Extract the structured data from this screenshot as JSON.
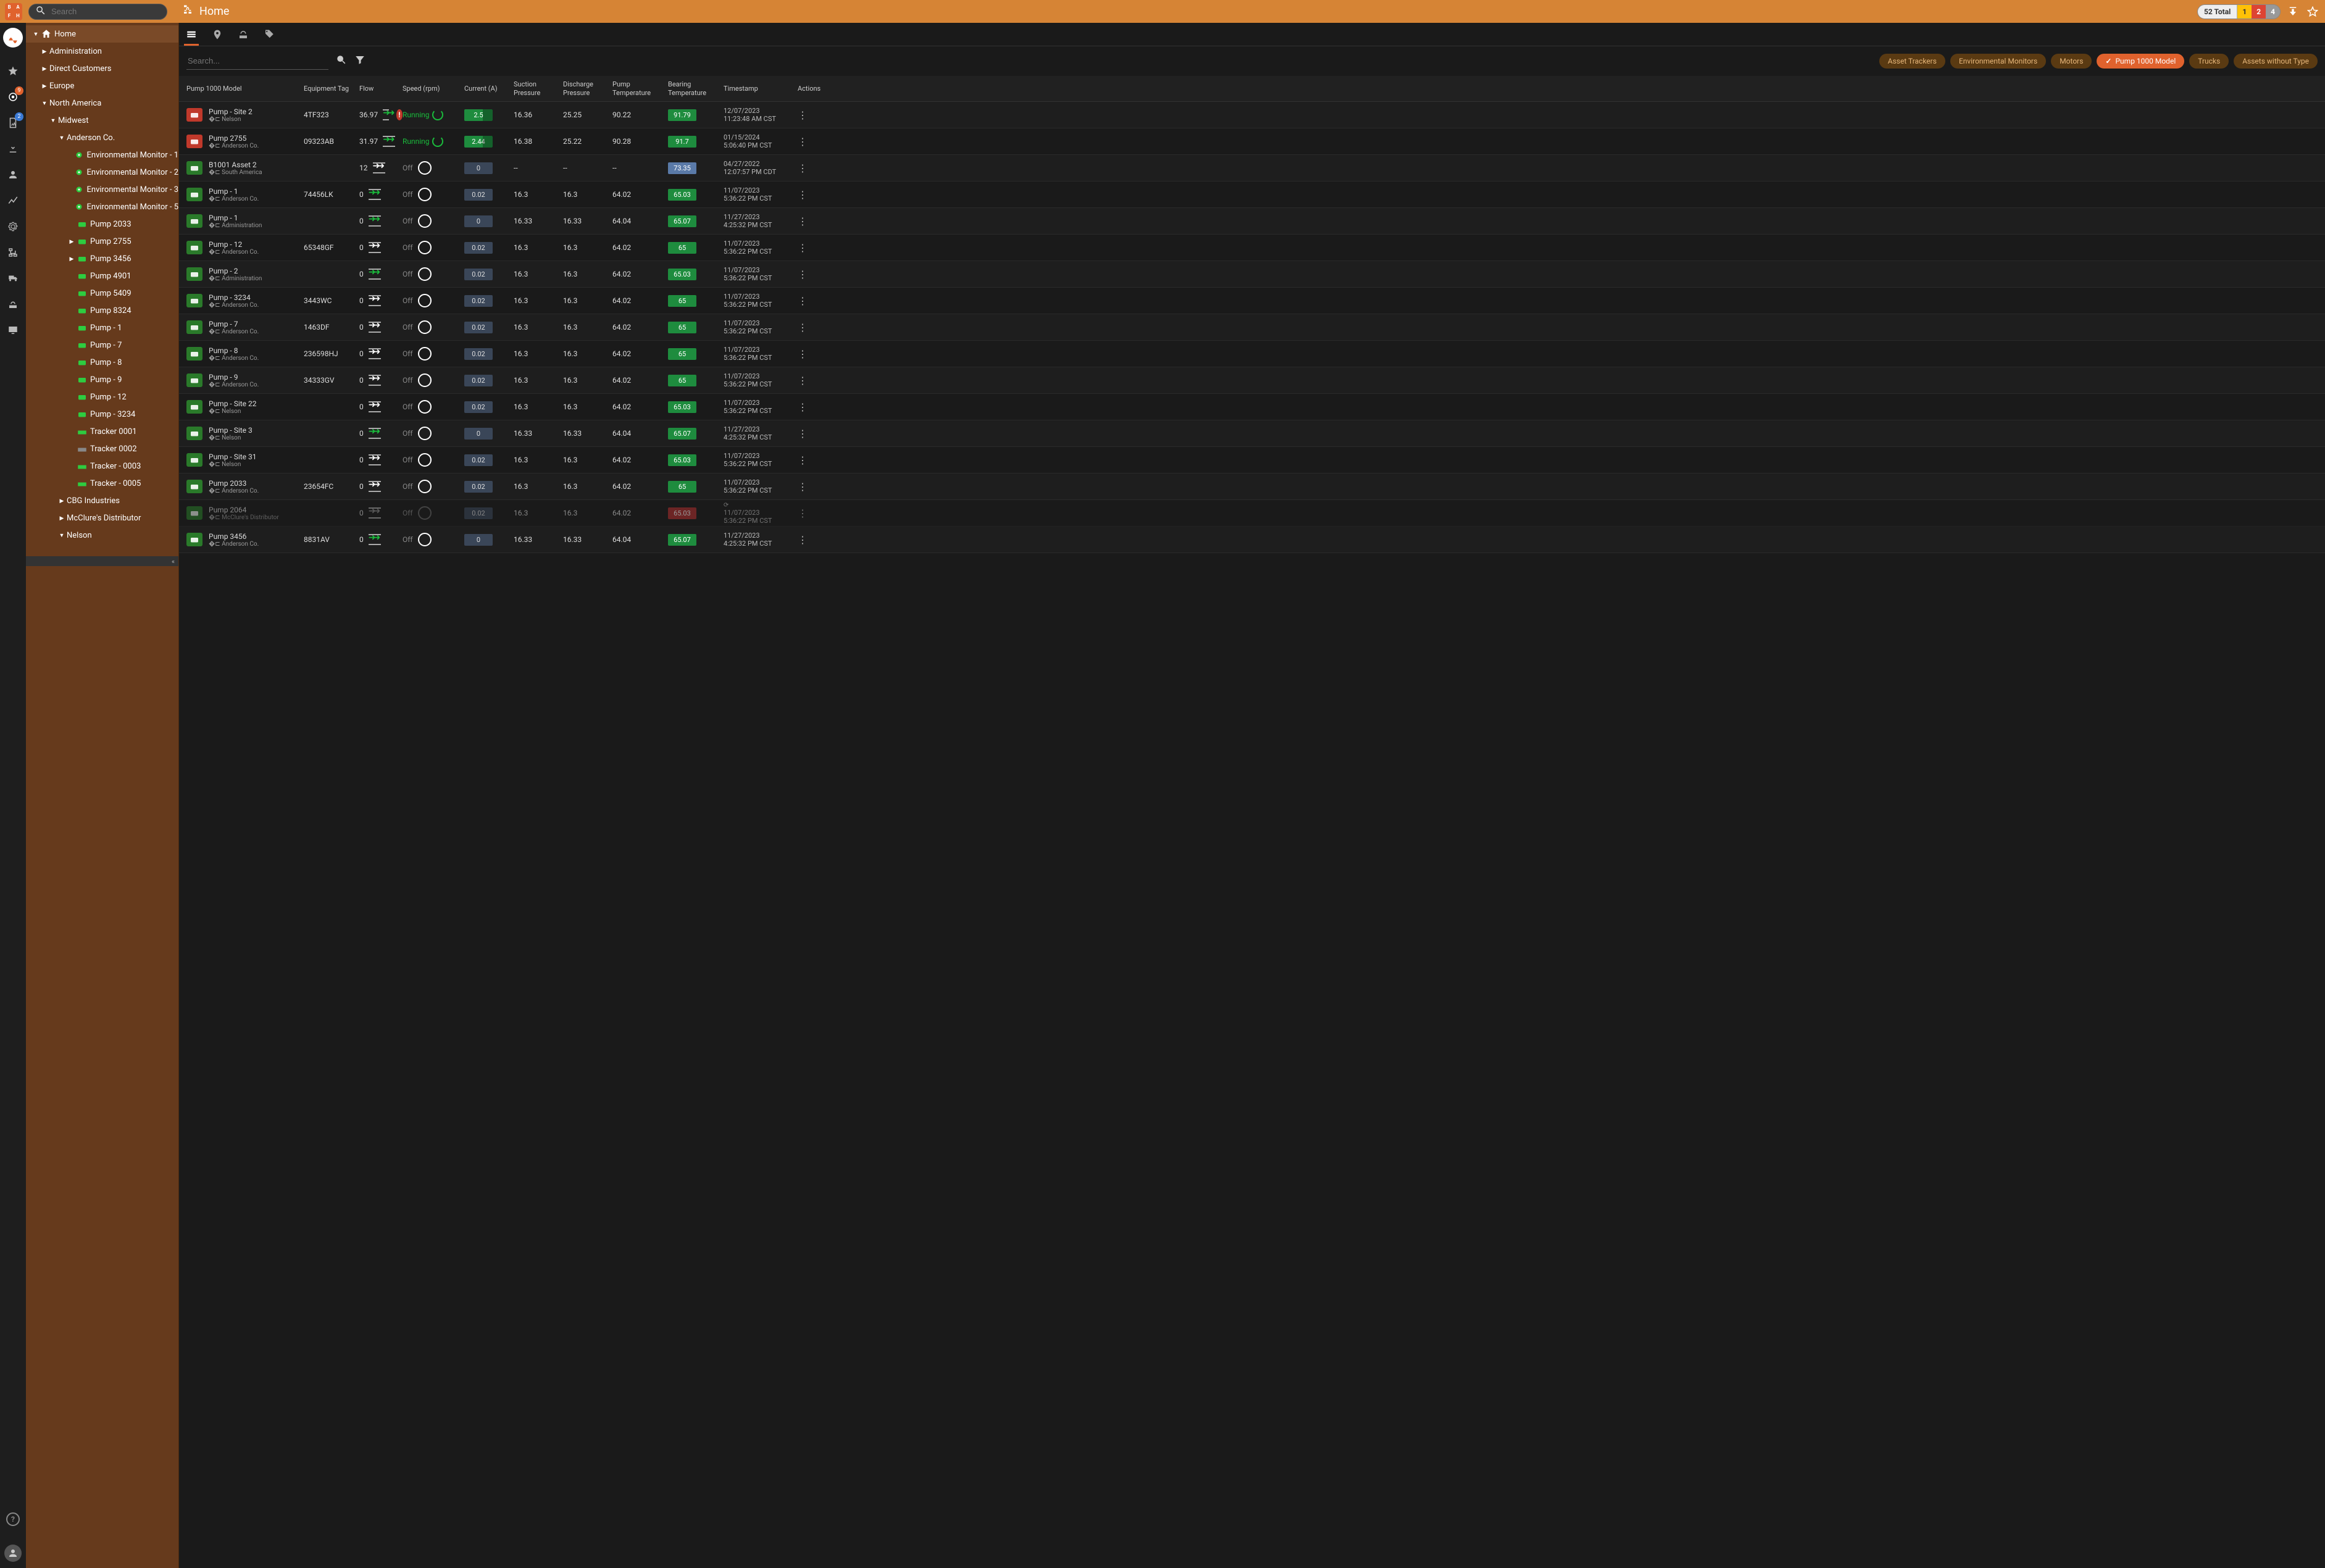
{
  "header": {
    "badge_letters": [
      "B",
      "A",
      "F",
      "H"
    ],
    "search_placeholder": "Search",
    "breadcrumb_title": "Home",
    "total_label": "52 Total",
    "counts": {
      "yellow": "1",
      "red": "2",
      "gray": "4"
    }
  },
  "rail": {
    "badge1": "9",
    "badge2": "2"
  },
  "tree": [
    {
      "level": 0,
      "chev": "down",
      "type": "home",
      "label": "Home",
      "selected": true
    },
    {
      "level": 1,
      "chev": "right",
      "type": "",
      "label": "Administration"
    },
    {
      "level": 1,
      "chev": "right",
      "type": "",
      "label": "Direct Customers"
    },
    {
      "level": 1,
      "chev": "right",
      "type": "",
      "label": "Europe"
    },
    {
      "level": 1,
      "chev": "down",
      "type": "",
      "label": "North America"
    },
    {
      "level": 2,
      "chev": "down",
      "type": "",
      "label": "Midwest"
    },
    {
      "level": 3,
      "chev": "down",
      "type": "",
      "label": "Anderson Co."
    },
    {
      "level": 4,
      "chev": "",
      "type": "env",
      "label": "Environmental Monitor - 1"
    },
    {
      "level": 4,
      "chev": "",
      "type": "env",
      "label": "Environmental Monitor - 2"
    },
    {
      "level": 4,
      "chev": "",
      "type": "env",
      "label": "Environmental Monitor - 3"
    },
    {
      "level": 4,
      "chev": "",
      "type": "env",
      "label": "Environmental Monitor - 5"
    },
    {
      "level": 4,
      "chev": "",
      "type": "pump",
      "label": "Pump 2033"
    },
    {
      "level": 4,
      "chev": "right",
      "type": "pump",
      "label": "Pump 2755"
    },
    {
      "level": 4,
      "chev": "right",
      "type": "pump",
      "label": "Pump 3456"
    },
    {
      "level": 4,
      "chev": "",
      "type": "pump",
      "label": "Pump 4901"
    },
    {
      "level": 4,
      "chev": "",
      "type": "pump",
      "label": "Pump 5409"
    },
    {
      "level": 4,
      "chev": "",
      "type": "pump",
      "label": "Pump 8324"
    },
    {
      "level": 4,
      "chev": "",
      "type": "pump",
      "label": "Pump - 1"
    },
    {
      "level": 4,
      "chev": "",
      "type": "pump",
      "label": "Pump - 7"
    },
    {
      "level": 4,
      "chev": "",
      "type": "pump",
      "label": "Pump - 8"
    },
    {
      "level": 4,
      "chev": "",
      "type": "pump",
      "label": "Pump - 9"
    },
    {
      "level": 4,
      "chev": "",
      "type": "pump",
      "label": "Pump - 12"
    },
    {
      "level": 4,
      "chev": "",
      "type": "pump",
      "label": "Pump - 3234"
    },
    {
      "level": 4,
      "chev": "",
      "type": "tracker",
      "label": "Tracker 0001"
    },
    {
      "level": 4,
      "chev": "",
      "type": "tracker-gray",
      "label": "Tracker 0002"
    },
    {
      "level": 4,
      "chev": "",
      "type": "tracker",
      "label": "Tracker - 0003"
    },
    {
      "level": 4,
      "chev": "",
      "type": "tracker",
      "label": "Tracker - 0005"
    },
    {
      "level": 3,
      "chev": "right",
      "type": "",
      "label": "CBG Industries"
    },
    {
      "level": 3,
      "chev": "right",
      "type": "",
      "label": "McClure's Distributor"
    },
    {
      "level": 3,
      "chev": "down",
      "type": "",
      "label": "Nelson"
    }
  ],
  "filters": {
    "search_placeholder": "Search...",
    "chips": [
      "Asset Trackers",
      "Environmental Monitors",
      "Motors",
      "Pump 1000 Model",
      "Trucks",
      "Assets without Type"
    ],
    "active_chip": 3
  },
  "columns": [
    "Pump 1000 Model",
    "Equipment Tag",
    "Flow",
    "Speed (rpm)",
    "Current (A)",
    "Suction Pressure",
    "Discharge Pressure",
    "Pump Temperature",
    "Bearing Temperature",
    "Timestamp",
    "Actions"
  ],
  "rows": [
    {
      "ic": "red",
      "name": "Pump - Site 2",
      "loc": "Nelson",
      "tag": "4TF323",
      "flow": "36.97",
      "flowic": "running",
      "alert": true,
      "speed": "Running",
      "run": true,
      "cur": {
        "v": "2.5",
        "c": "green"
      },
      "sp": "16.36",
      "dp": "25.25",
      "pt": "90.22",
      "bt": {
        "v": "91.79",
        "c": "green"
      },
      "t1": "12/07/2023",
      "t2": "11:23:48 AM CST"
    },
    {
      "ic": "red",
      "name": "Pump 2755",
      "loc": "Anderson Co.",
      "tag": "09323AB",
      "flow": "31.97",
      "flowic": "running",
      "speed": "Running",
      "run": true,
      "cur": {
        "v": "2.44",
        "c": "green"
      },
      "sp": "16.38",
      "dp": "25.22",
      "pt": "90.28",
      "bt": {
        "v": "91.7",
        "c": "green"
      },
      "t1": "01/15/2024",
      "t2": "5:06:40 PM CST"
    },
    {
      "ic": "green",
      "name": "B1001 Asset 2",
      "loc": "South America",
      "tag": "",
      "flow": "12",
      "flowic": "white",
      "speed": "Off",
      "run": false,
      "cur": {
        "v": "0",
        "c": "dark"
      },
      "sp": "--",
      "dp": "--",
      "pt": "--",
      "bt": {
        "v": "73.35",
        "c": "blue"
      },
      "t1": "04/27/2022",
      "t2": "12:07:57 PM CDT"
    },
    {
      "ic": "green",
      "name": "Pump - 1",
      "loc": "Anderson Co.",
      "tag": "74456LK",
      "flow": "0",
      "flowic": "running",
      "speed": "Off",
      "run": false,
      "cur": {
        "v": "0.02",
        "c": "dark"
      },
      "sp": "16.3",
      "dp": "16.3",
      "pt": "64.02",
      "bt": {
        "v": "65.03",
        "c": "green"
      },
      "t1": "11/07/2023",
      "t2": "5:36:22 PM CST"
    },
    {
      "ic": "green",
      "name": "Pump - 1",
      "loc": "Administration",
      "tag": "",
      "flow": "0",
      "flowic": "running",
      "speed": "Off",
      "run": false,
      "cur": {
        "v": "0",
        "c": "dark"
      },
      "sp": "16.33",
      "dp": "16.33",
      "pt": "64.04",
      "bt": {
        "v": "65.07",
        "c": "green"
      },
      "t1": "11/27/2023",
      "t2": "4:25:32 PM CST"
    },
    {
      "ic": "green",
      "name": "Pump - 12",
      "loc": "Anderson Co.",
      "tag": "65348GF",
      "flow": "0",
      "flowic": "white",
      "speed": "Off",
      "run": false,
      "cur": {
        "v": "0.02",
        "c": "dark"
      },
      "sp": "16.3",
      "dp": "16.3",
      "pt": "64.02",
      "bt": {
        "v": "65",
        "c": "green"
      },
      "t1": "11/07/2023",
      "t2": "5:36:22 PM CST"
    },
    {
      "ic": "green",
      "name": "Pump - 2",
      "loc": "Administration",
      "tag": "",
      "flow": "0",
      "flowic": "running",
      "speed": "Off",
      "run": false,
      "cur": {
        "v": "0.02",
        "c": "dark"
      },
      "sp": "16.3",
      "dp": "16.3",
      "pt": "64.02",
      "bt": {
        "v": "65.03",
        "c": "green"
      },
      "t1": "11/07/2023",
      "t2": "5:36:22 PM CST"
    },
    {
      "ic": "green",
      "name": "Pump - 3234",
      "loc": "Anderson Co.",
      "tag": "3443WC",
      "flow": "0",
      "flowic": "white",
      "speed": "Off",
      "run": false,
      "cur": {
        "v": "0.02",
        "c": "dark"
      },
      "sp": "16.3",
      "dp": "16.3",
      "pt": "64.02",
      "bt": {
        "v": "65",
        "c": "green"
      },
      "t1": "11/07/2023",
      "t2": "5:36:22 PM CST"
    },
    {
      "ic": "green",
      "name": "Pump - 7",
      "loc": "Anderson Co.",
      "tag": "1463DF",
      "flow": "0",
      "flowic": "white",
      "speed": "Off",
      "run": false,
      "cur": {
        "v": "0.02",
        "c": "dark"
      },
      "sp": "16.3",
      "dp": "16.3",
      "pt": "64.02",
      "bt": {
        "v": "65",
        "c": "green"
      },
      "t1": "11/07/2023",
      "t2": "5:36:22 PM CST"
    },
    {
      "ic": "green",
      "name": "Pump - 8",
      "loc": "Anderson Co.",
      "tag": "236598HJ",
      "flow": "0",
      "flowic": "white",
      "speed": "Off",
      "run": false,
      "cur": {
        "v": "0.02",
        "c": "dark"
      },
      "sp": "16.3",
      "dp": "16.3",
      "pt": "64.02",
      "bt": {
        "v": "65",
        "c": "green"
      },
      "t1": "11/07/2023",
      "t2": "5:36:22 PM CST"
    },
    {
      "ic": "green",
      "name": "Pump - 9",
      "loc": "Anderson Co.",
      "tag": "34333GV",
      "flow": "0",
      "flowic": "white",
      "speed": "Off",
      "run": false,
      "cur": {
        "v": "0.02",
        "c": "dark"
      },
      "sp": "16.3",
      "dp": "16.3",
      "pt": "64.02",
      "bt": {
        "v": "65",
        "c": "green"
      },
      "t1": "11/07/2023",
      "t2": "5:36:22 PM CST"
    },
    {
      "ic": "green",
      "name": "Pump - Site 22",
      "loc": "Nelson",
      "tag": "",
      "flow": "0",
      "flowic": "white",
      "speed": "Off",
      "run": false,
      "cur": {
        "v": "0.02",
        "c": "dark"
      },
      "sp": "16.3",
      "dp": "16.3",
      "pt": "64.02",
      "bt": {
        "v": "65.03",
        "c": "green"
      },
      "t1": "11/07/2023",
      "t2": "5:36:22 PM CST"
    },
    {
      "ic": "green",
      "name": "Pump - Site 3",
      "loc": "Nelson",
      "tag": "",
      "flow": "0",
      "flowic": "running",
      "speed": "Off",
      "run": false,
      "cur": {
        "v": "0",
        "c": "dark"
      },
      "sp": "16.33",
      "dp": "16.33",
      "pt": "64.04",
      "bt": {
        "v": "65.07",
        "c": "green"
      },
      "t1": "11/27/2023",
      "t2": "4:25:32 PM CST"
    },
    {
      "ic": "green",
      "name": "Pump - Site 31",
      "loc": "Nelson",
      "tag": "",
      "flow": "0",
      "flowic": "white",
      "speed": "Off",
      "run": false,
      "cur": {
        "v": "0.02",
        "c": "dark"
      },
      "sp": "16.3",
      "dp": "16.3",
      "pt": "64.02",
      "bt": {
        "v": "65.03",
        "c": "green"
      },
      "t1": "11/07/2023",
      "t2": "5:36:22 PM CST"
    },
    {
      "ic": "green",
      "name": "Pump 2033",
      "loc": "Anderson Co.",
      "tag": "23654FC",
      "flow": "0",
      "flowic": "white",
      "speed": "Off",
      "run": false,
      "cur": {
        "v": "0.02",
        "c": "dark"
      },
      "sp": "16.3",
      "dp": "16.3",
      "pt": "64.02",
      "bt": {
        "v": "65",
        "c": "green"
      },
      "t1": "11/07/2023",
      "t2": "5:36:22 PM CST"
    },
    {
      "ic": "green",
      "name": "Pump 2064",
      "loc": "McClure's Distributor",
      "tag": "",
      "flow": "0",
      "flowic": "off",
      "speed": "Off",
      "run": false,
      "stale": true,
      "cur": {
        "v": "0.02",
        "c": "dark"
      },
      "sp": "16.3",
      "dp": "16.3",
      "pt": "64.02",
      "bt": {
        "v": "65.03",
        "c": "red"
      },
      "t1": "11/07/2023",
      "t2": "5:36:22 PM CST"
    },
    {
      "ic": "green",
      "name": "Pump 3456",
      "loc": "Anderson Co.",
      "tag": "8831AV",
      "flow": "0",
      "flowic": "running",
      "speed": "Off",
      "run": false,
      "cur": {
        "v": "0",
        "c": "dark"
      },
      "sp": "16.33",
      "dp": "16.33",
      "pt": "64.04",
      "bt": {
        "v": "65.07",
        "c": "green"
      },
      "t1": "11/27/2023",
      "t2": "4:25:32 PM CST"
    }
  ]
}
